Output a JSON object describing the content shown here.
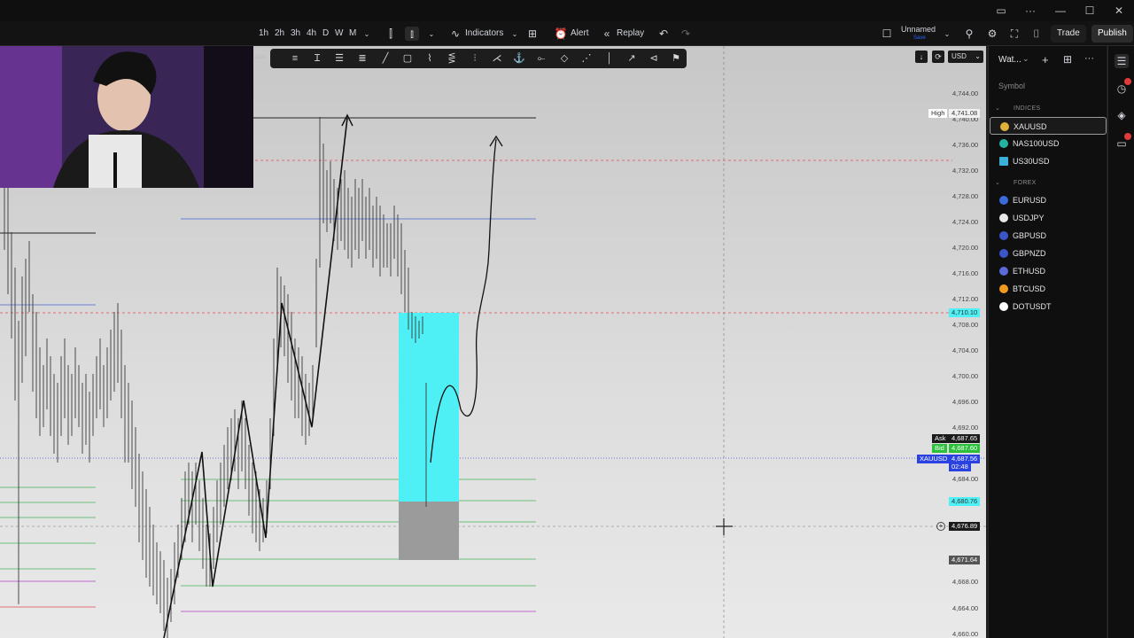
{
  "titlebar": {
    "controls": [
      "—",
      "☐",
      "✕"
    ]
  },
  "toolbar": {
    "timeframes": [
      "1h",
      "2h",
      "3h",
      "4h",
      "D",
      "W",
      "M"
    ],
    "indicators_label": "Indicators",
    "alert_label": "Alert",
    "replay_label": "Replay",
    "layout_name": "Unnamed",
    "layout_status": "Save",
    "trade_label": "Trade",
    "publish_label": "Publish"
  },
  "chart": {
    "currency": "USD",
    "high_label": "High",
    "high_value": "4,741.08",
    "price_ticks": [
      "4,744.00",
      "4,740.00",
      "4,736.00",
      "4,732.00",
      "4,728.00",
      "4,724.00",
      "4,720.00",
      "4,716.00",
      "4,712.00",
      "4,708.00",
      "4,704.00",
      "4,700.00",
      "4,696.00",
      "4,692.00",
      "4,684.00",
      "4,668.00",
      "4,664.00",
      "4,660.00"
    ],
    "left_partial_price": "684.",
    "tag_4710": "4,710.10",
    "ask_label": "Ask",
    "ask_value": "4,687.65",
    "bid_label": "Bid",
    "bid_value": "4,687.60",
    "symbol_tag": "XAUUSD",
    "last_price": "4,687.56",
    "countdown": "02:48",
    "tag_4680": "4,680.76",
    "crosshair_price": "4,676.89",
    "tag_4671": "4,671.64",
    "colors": {
      "cyan": "#4ef0f5",
      "gray_box": "#9b9b9b",
      "ask": "#1b1b1b",
      "bid": "#2bbf3a",
      "last": "#2a43e0",
      "red_dash": "#e34a5a"
    }
  },
  "watchlist": {
    "title": "Wat...",
    "symbol_header": "Symbol",
    "groups": [
      {
        "name": "INDICES",
        "items": [
          {
            "symbol": "XAUUSD",
            "icon": "gold-icon",
            "color": "#e0b23a"
          },
          {
            "symbol": "NAS100USD",
            "icon": "nasdaq-icon",
            "color": "#22b3a3"
          },
          {
            "symbol": "US30USD",
            "icon": "dow-icon",
            "color": "#3ab0d8"
          }
        ]
      },
      {
        "name": "FOREX",
        "items": [
          {
            "symbol": "EURUSD",
            "icon": "euro-flag-icon",
            "color": "#3a6bd8"
          },
          {
            "symbol": "USDJPY",
            "icon": "us-flag-icon",
            "color": "#e9e9e9"
          },
          {
            "symbol": "GBPUSD",
            "icon": "uk-flag-icon",
            "color": "#3a56c8"
          },
          {
            "symbol": "GBPNZD",
            "icon": "uk-flag-icon",
            "color": "#3a56c8"
          },
          {
            "symbol": "ETHUSD",
            "icon": "ethereum-icon",
            "color": "#5a6ad8"
          },
          {
            "symbol": "BTCUSD",
            "icon": "bitcoin-icon",
            "color": "#f29a1f"
          },
          {
            "symbol": "DOTUSDT",
            "icon": "polkadot-icon",
            "color": "#ffffff"
          }
        ]
      }
    ]
  }
}
